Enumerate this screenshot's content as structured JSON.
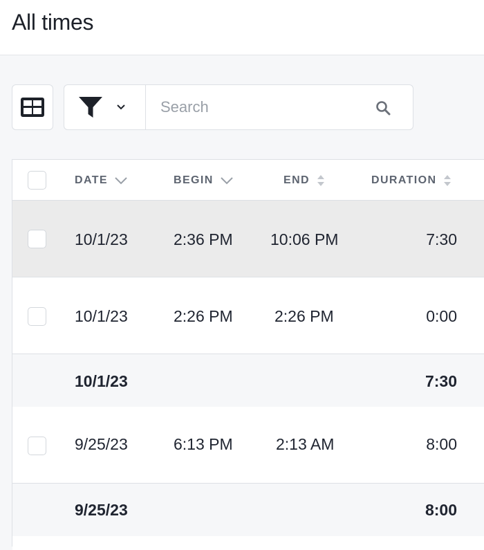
{
  "header": {
    "title": "All times"
  },
  "toolbar": {
    "view_icon": "table-view-icon",
    "filter_icon": "funnel-icon",
    "search": {
      "placeholder": "Search",
      "value": ""
    }
  },
  "table": {
    "columns": [
      {
        "label": "DATE",
        "sort": "chevron-down"
      },
      {
        "label": "BEGIN",
        "sort": "chevron-down"
      },
      {
        "label": "END",
        "sort": "sort-both"
      },
      {
        "label": "DURATION",
        "sort": "sort-both"
      }
    ],
    "rows": [
      {
        "type": "entry",
        "date": "10/1/23",
        "begin": "2:36 PM",
        "end": "10:06 PM",
        "duration": "7:30",
        "highlighted": true
      },
      {
        "type": "entry",
        "date": "10/1/23",
        "begin": "2:26 PM",
        "end": "2:26 PM",
        "duration": "0:00",
        "highlighted": false
      },
      {
        "type": "group",
        "date": "10/1/23",
        "duration": "7:30"
      },
      {
        "type": "entry",
        "date": "9/25/23",
        "begin": "6:13 PM",
        "end": "2:13 AM",
        "duration": "8:00",
        "highlighted": false
      },
      {
        "type": "group",
        "date": "9/25/23",
        "duration": "8:00"
      }
    ]
  }
}
